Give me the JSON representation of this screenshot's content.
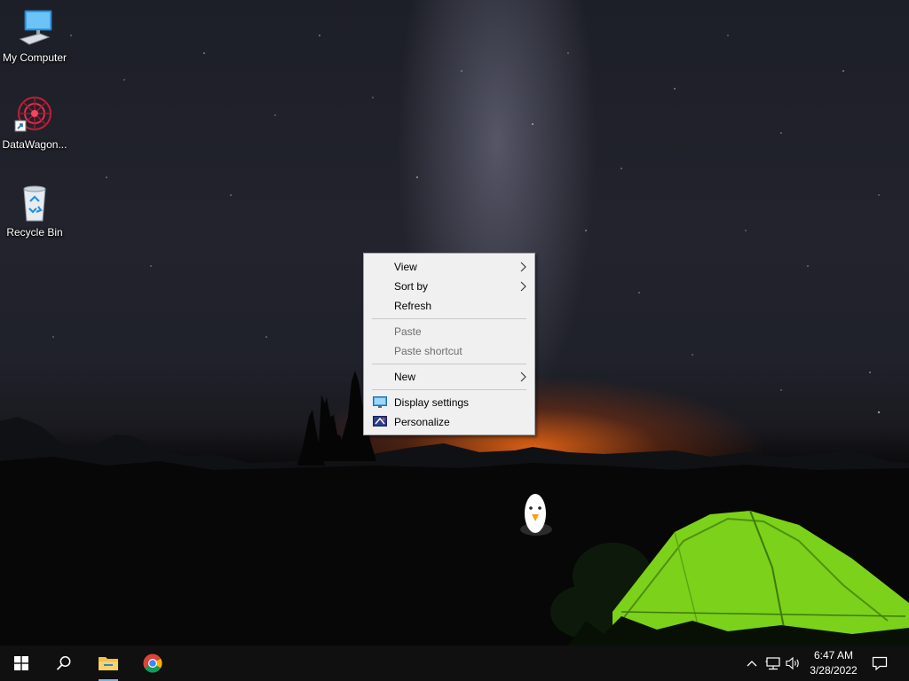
{
  "desktop": {
    "icons": [
      {
        "label": "My Computer",
        "icon": "computer-icon"
      },
      {
        "label": "DataWagon...",
        "icon": "datawagon-icon"
      },
      {
        "label": "Recycle Bin",
        "icon": "recycle-bin-icon"
      }
    ]
  },
  "context_menu": {
    "items": [
      {
        "label": "View",
        "submenu": true,
        "enabled": true
      },
      {
        "label": "Sort by",
        "submenu": true,
        "enabled": true
      },
      {
        "label": "Refresh",
        "submenu": false,
        "enabled": true
      },
      {
        "label": "Paste",
        "submenu": false,
        "enabled": false
      },
      {
        "label": "Paste shortcut",
        "submenu": false,
        "enabled": false
      },
      {
        "label": "New",
        "submenu": true,
        "enabled": true
      },
      {
        "label": "Display settings",
        "icon": "display-settings-icon",
        "enabled": true
      },
      {
        "label": "Personalize",
        "icon": "personalize-icon",
        "enabled": true
      }
    ]
  },
  "taskbar": {
    "start": {
      "icon": "windows-start-icon"
    },
    "search": {
      "icon": "search-icon"
    },
    "pinned": [
      {
        "icon": "file-explorer-icon",
        "active": true
      },
      {
        "icon": "chrome-icon",
        "active": false
      }
    ],
    "tray": {
      "icons": [
        "chevron-up-icon",
        "network-icon",
        "volume-icon"
      ],
      "time": "6:47 AM",
      "date": "3/28/2022",
      "notification_icon": "action-center-icon"
    }
  },
  "colors": {
    "menu_bg": "#f0f0f0",
    "taskbar_bg": "#101010",
    "tent": "#7cd11a",
    "sunset": "#ff6e14"
  }
}
